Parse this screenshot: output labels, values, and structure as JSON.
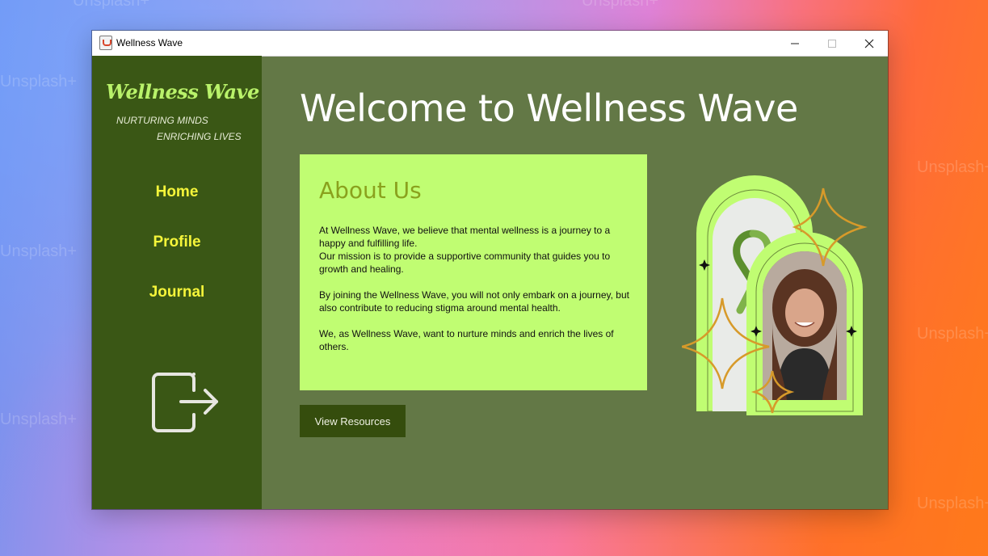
{
  "window": {
    "title": "Wellness Wave"
  },
  "background": {
    "watermark": "Unsplash+"
  },
  "sidebar": {
    "brand": "Wellness Wave",
    "tagline_1": "NURTURING MINDS",
    "tagline_2": "ENRICHING LIVES",
    "nav": {
      "home": "Home",
      "profile": "Profile",
      "journal": "Journal"
    }
  },
  "main": {
    "headline": "Welcome to Wellness Wave",
    "about": {
      "title": "About Us",
      "body": "At Wellness Wave, we believe that mental wellness is a journey to a happy and fulfilling life.\nOur mission is to provide a supportive community that guides you to growth and healing.\n\nBy joining the Wellness Wave, you will not only embark on a journey, but also contribute to reducing stigma around mental health.\n\nWe, as Wellness Wave, want to nurture minds and enrich the lives of others."
    },
    "resources_button": "View Resources"
  },
  "colors": {
    "sidebar": "#3a5715",
    "main": "#637846",
    "card": "#c0fd72",
    "brand": "#b9f26a",
    "nav": "#f5f53a",
    "button": "#354d0d",
    "accent": "#d79a2a"
  },
  "icons": [
    "java-app-icon",
    "minimize-icon",
    "maximize-icon",
    "close-icon",
    "logout-icon",
    "green-ribbon-icon",
    "sparkle-icon"
  ]
}
